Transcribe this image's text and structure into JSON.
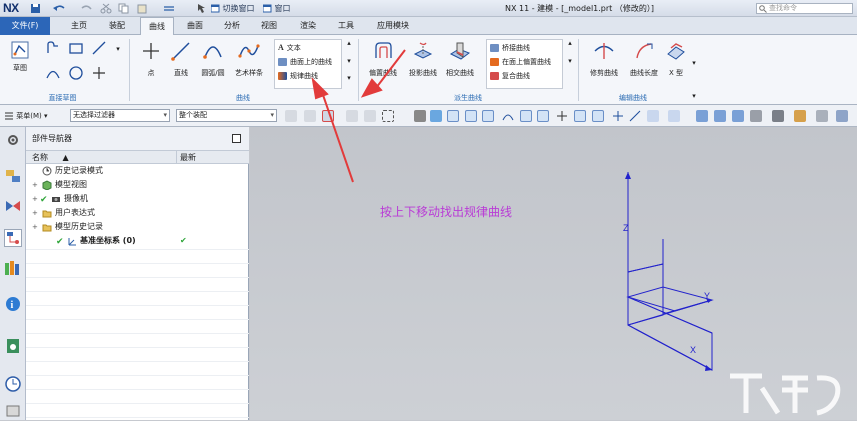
{
  "app": {
    "logo": "NX",
    "window_title": "NX 11 - 建模 - [_model1.prt （修改的）]",
    "search_placeholder": "查找命令",
    "quick_access": {
      "switch_window": "切换窗口",
      "window": "窗口"
    }
  },
  "tabs": [
    {
      "label": "文件(F)"
    },
    {
      "label": "主页"
    },
    {
      "label": "装配"
    },
    {
      "label": "曲线"
    },
    {
      "label": "曲面"
    },
    {
      "label": "分析"
    },
    {
      "label": "视图"
    },
    {
      "label": "渲染"
    },
    {
      "label": "工具"
    },
    {
      "label": "应用模块"
    }
  ],
  "active_tab": "曲线",
  "ribbon": {
    "groups": {
      "direct_sketch": {
        "label": "直接草图",
        "sketch_label": "草图"
      },
      "curve": {
        "label": "曲线",
        "point": "点",
        "line": "直线",
        "arc": "圆弧/圆",
        "studio_spline": "艺术样条",
        "gallery": [
          "文本",
          "曲面上的曲线",
          "规律曲线"
        ]
      },
      "derived": {
        "label": "派生曲线",
        "offset": "偏置曲线",
        "project": "投影曲线",
        "intersect": "相交曲线",
        "gallery": [
          "桥接曲线",
          "在面上偏置曲线",
          "复合曲线"
        ]
      },
      "edit": {
        "label": "编辑曲线",
        "trim": "修剪曲线",
        "length": "曲线长度",
        "xform": "X 型"
      }
    }
  },
  "toolbar": {
    "menu_label": "菜单(M)",
    "selection_filter": "无选择过滤器",
    "scope": "整个装配"
  },
  "part_navigator": {
    "title": "部件导航器",
    "col_name": "名称",
    "col_latest": "最新",
    "nodes": [
      {
        "label": "历史记录模式",
        "checked": false
      },
      {
        "label": "模型视图",
        "checked": false
      },
      {
        "label": "摄像机",
        "checked": true
      },
      {
        "label": "用户表达式",
        "checked": false
      },
      {
        "label": "模型历史记录",
        "checked": false
      },
      {
        "label": "基准坐标系 (0)",
        "checked": true,
        "latest": "✔"
      }
    ]
  },
  "viewport": {
    "annotation": "按上下移动找出规律曲线",
    "axes": {
      "x": "X",
      "y": "Y",
      "z": "Z"
    },
    "annotation_color": "#b93bd6",
    "axis_color": "#2222cc",
    "arrow_color": "#e23b3b"
  },
  "colors": {
    "accent": "#2c66b8",
    "group_label": "#2a6bb3"
  }
}
